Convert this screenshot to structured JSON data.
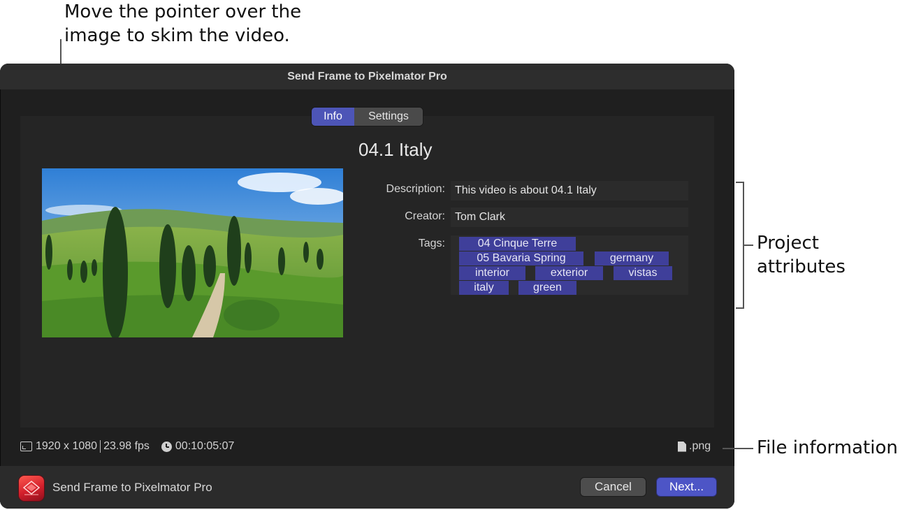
{
  "callouts": {
    "skim_line1": "Move the pointer over the",
    "skim_line2": "image to skim the video.",
    "project_line1": "Project",
    "project_line2": "attributes",
    "file_info": "File information"
  },
  "window": {
    "title": "Send Frame to Pixelmator Pro"
  },
  "tabs": {
    "info": "Info",
    "settings": "Settings",
    "selected": "Info"
  },
  "project": {
    "title": "04.1 Italy",
    "description_label": "Description:",
    "description_value": "This video is about 04.1 Italy",
    "creator_label": "Creator:",
    "creator_value": "Tom Clark",
    "tags_label": "Tags:",
    "tags": [
      "04 Cinque Terre",
      "05 Bavaria Spring",
      "germany",
      "interior",
      "exterior",
      "vistas",
      "italy",
      "green"
    ]
  },
  "file": {
    "resolution": "1920 x 1080",
    "framerate": "23.98 fps",
    "timecode": "00:10:05:07",
    "extension": ".png"
  },
  "footer": {
    "app_name": "Send Frame to Pixelmator Pro",
    "cancel": "Cancel",
    "next": "Next..."
  },
  "colors": {
    "accent": "#4d55c6",
    "tag_bg": "#3f3f9a",
    "window_bg": "#1f1f1f"
  }
}
